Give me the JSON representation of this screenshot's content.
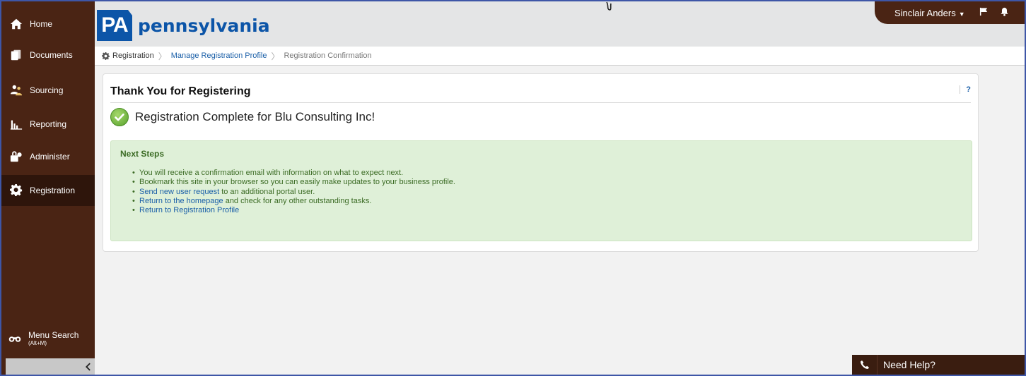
{
  "sidebar": {
    "items": [
      {
        "label": "Home",
        "icon": "home-icon"
      },
      {
        "label": "Documents",
        "icon": "documents-icon"
      },
      {
        "label": "Sourcing",
        "icon": "sourcing-icon"
      },
      {
        "label": "Reporting",
        "icon": "reporting-icon"
      },
      {
        "label": "Administer",
        "icon": "administer-icon"
      },
      {
        "label": "Registration",
        "icon": "gear-icon"
      }
    ],
    "active": "Registration",
    "menu_search": {
      "label": "Menu Search",
      "hint": "(Alt+M)"
    }
  },
  "header": {
    "logo_mark": "PA",
    "logo_word": "pennsylvania",
    "user_name": "Sinclair Anders"
  },
  "breadcrumb": {
    "items": [
      "Registration",
      "Manage Registration Profile",
      "Registration Confirmation"
    ]
  },
  "card": {
    "title": "Thank You for Registering",
    "help_label": "?",
    "complete_message": "Registration Complete for Blu Consulting Inc!",
    "next_steps": {
      "title": "Next Steps",
      "item1": "You will receive a confirmation email with information on what to expect next.",
      "item2": "Bookmark this site in your browser so you can easily make updates to your business profile.",
      "item3_link": "Send new user request",
      "item3_text": " to an additional portal user.",
      "item4_link": "Return to the homepage",
      "item4_text": " and check for any other outstanding tasks.",
      "item5_link": "Return to Registration Profile"
    }
  },
  "need_help": {
    "label": "Need Help?"
  },
  "colors": {
    "sidebar_bg": "#4a2414",
    "sidebar_active": "#2e150b",
    "brand_blue": "#0c55a8",
    "link": "#1a5fa8",
    "success_bg": "#dff0d8",
    "success_text": "#3b6b24"
  }
}
